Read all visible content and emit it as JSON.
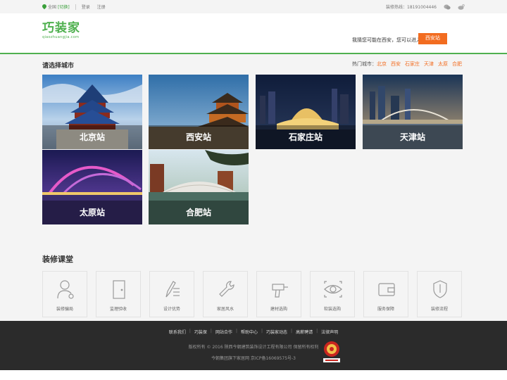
{
  "topbar": {
    "location": "全国",
    "switch": "[切换]",
    "login": "登录",
    "register": "注册",
    "hotline": "装修热线：18191004446"
  },
  "header": {
    "logo_cn": "巧装家",
    "logo_en": "qiaozhuangjia.com",
    "guess_text": "我猜您可能在西安，您可以进入",
    "guess_button": "西安站"
  },
  "city_select": {
    "title": "请选择城市",
    "hot_label": "热门城市：",
    "hot_cities": [
      "北京",
      "西安",
      "石家庄",
      "天津",
      "太原",
      "合肥"
    ],
    "cards": [
      {
        "label": "北京站"
      },
      {
        "label": "西安站"
      },
      {
        "label": "石家庄站"
      },
      {
        "label": "天津站"
      },
      {
        "label": "太原站"
      },
      {
        "label": "合肥站"
      }
    ]
  },
  "courses": {
    "title": "装修课堂",
    "items": [
      {
        "label": "装修骗局",
        "icon": "user-alert-icon"
      },
      {
        "label": "监理验收",
        "icon": "door-icon"
      },
      {
        "label": "设计优势",
        "icon": "pencil-list-icon"
      },
      {
        "label": "家居风水",
        "icon": "wrench-icon"
      },
      {
        "label": "建材选购",
        "icon": "drill-icon"
      },
      {
        "label": "软装选购",
        "icon": "eye-icon"
      },
      {
        "label": "服务保障",
        "icon": "wallet-icon"
      },
      {
        "label": "装修流程",
        "icon": "shield-icon"
      }
    ]
  },
  "footer": {
    "links": [
      "联系我们",
      "巧装保",
      "网站合作",
      "帮助中心",
      "巧装家动态",
      "高薪聘请",
      "法律声明"
    ],
    "copyright": "版权所有 © 2016 陕西今朝建筑装饰设计工程有限公司 保留所有权利",
    "icp": "今朝集团旗下家居网 京ICP备16069575号-3"
  },
  "colors": {
    "brand_green": "#4fb04f",
    "accent_orange": "#f26c20",
    "footer_bg": "#2b2b2b"
  }
}
